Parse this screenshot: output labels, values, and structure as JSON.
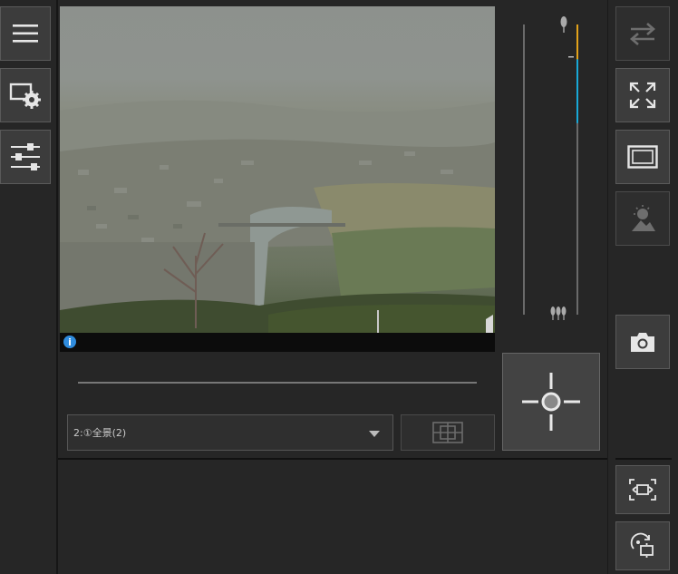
{
  "preset_select": {
    "value": "2:①全景(2)"
  },
  "info": {
    "glyph": "i"
  },
  "icons": {
    "menu": "hamburger-menu-icon",
    "settings": "monitor-settings-icon",
    "adjust": "sliders-icon",
    "swap": "swap-arrows-icon",
    "fullscreen": "expand-arrows-icon",
    "frame": "frame-icon",
    "scene": "scene-adjust-icon",
    "snapshot": "camera-icon",
    "crosshair": "crosshair-icon",
    "grid": "multi-screen-grid-icon",
    "fit": "fit-screen-icon",
    "rotate": "rotate-view-icon"
  },
  "colors": {
    "zoom_level_orange": "#e3a21a",
    "zoom_level_cyan": "#19a9d8",
    "info_blue": "#2f8cde"
  },
  "zoom_slider": {
    "orange_fraction": 0.12,
    "cyan_fraction": 0.22
  }
}
